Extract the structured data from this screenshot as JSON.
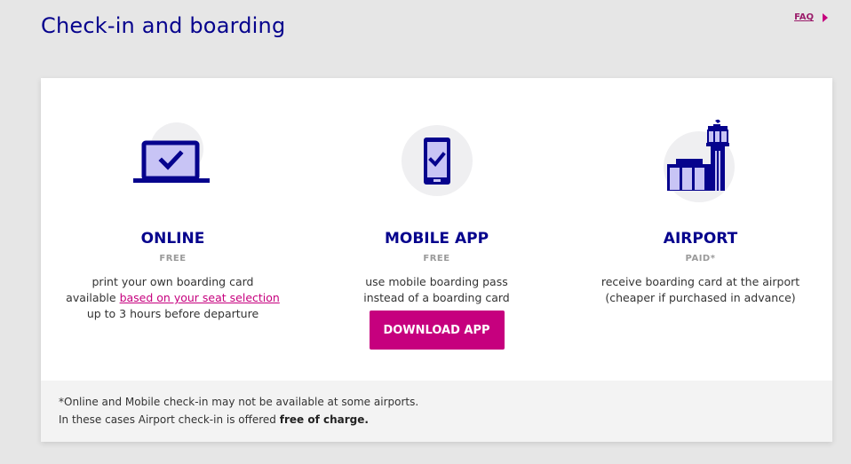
{
  "header": {
    "title": "Check-in and boarding",
    "faq_label": "FAQ"
  },
  "options": [
    {
      "name": "ONLINE",
      "price": "FREE",
      "line1": "print your own boarding card",
      "line2_prefix": "available ",
      "line2_link": "based on your seat selection",
      "line3": "up to 3 hours before departure",
      "icon": "laptop-check-icon"
    },
    {
      "name": "MOBILE APP",
      "price": "FREE",
      "line1": "use mobile boarding pass",
      "line2": "instead of a boarding card",
      "button_label": "DOWNLOAD APP",
      "icon": "mobile-check-icon"
    },
    {
      "name": "AIRPORT",
      "price": "PAID*",
      "line1": "receive boarding card at the airport",
      "line2": "(cheaper if purchased in advance)",
      "icon": "airport-tower-icon"
    }
  ],
  "note": {
    "line1": "*Online and Mobile check-in may not be available at some airports.",
    "line2_prefix": "In these cases Airport check-in is offered ",
    "line2_bold": "free of charge."
  },
  "colors": {
    "brand_navy": "#06038d",
    "brand_pink": "#c6007e",
    "icon_light": "#c8c4f5",
    "icon_circle": "#efeff1"
  }
}
